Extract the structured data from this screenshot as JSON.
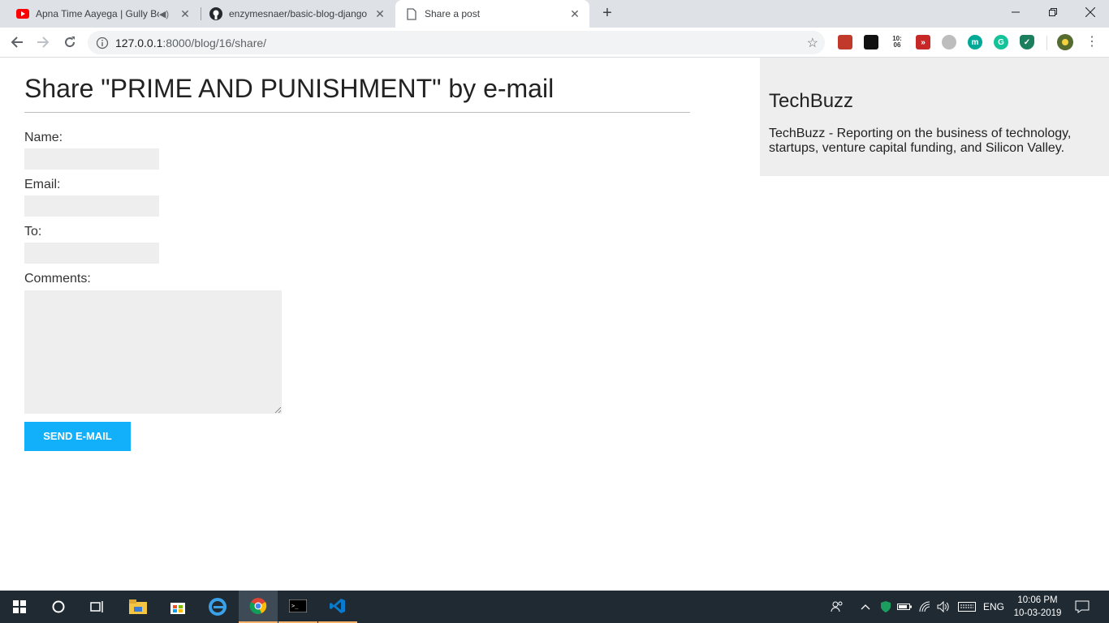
{
  "browser": {
    "tabs": [
      {
        "title": "Apna Time Aayega | Gully Bo",
        "audio": "speaker-icon"
      },
      {
        "title": "enzymesnaer/basic-blog-django"
      },
      {
        "title": "Share a post"
      }
    ],
    "address": {
      "host": "127.0.0.1",
      "path": ":8000/blog/16/share/"
    },
    "extensions": [
      {
        "icon": "bookmark-red-icon",
        "color": "#c0392b",
        "glyph": "■"
      },
      {
        "icon": "notes-black-icon",
        "color": "#111111",
        "glyph": "▆"
      },
      {
        "icon": "clock-badge-icon",
        "color": "#444444",
        "glyph": "10:06"
      },
      {
        "icon": "forward-red-icon",
        "color": "#c62828",
        "glyph": "»"
      },
      {
        "icon": "grey-circle-icon",
        "color": "#9e9e9e",
        "glyph": "◎"
      },
      {
        "icon": "m-teal-icon",
        "color": "#00a896",
        "glyph": "m"
      },
      {
        "icon": "grammarly-icon",
        "color": "#15c39a",
        "glyph": "G"
      },
      {
        "icon": "shield-green-icon",
        "color": "#1b7f5e",
        "glyph": "✓"
      }
    ]
  },
  "page": {
    "title": "Share \"PRIME AND PUNISHMENT\" by e-mail",
    "form": {
      "name_label": "Name:",
      "email_label": "Email:",
      "to_label": "To:",
      "comments_label": "Comments:",
      "submit_label": "SEND E-MAIL"
    },
    "sidebar": {
      "title": "TechBuzz",
      "description": "TechBuzz - Reporting on the business of technology, startups, venture capital funding, and Silicon Valley."
    }
  },
  "taskbar": {
    "language": "ENG",
    "time": "10:06 PM",
    "date": "10-03-2019"
  },
  "colors": {
    "accent_button": "#12b0fa",
    "sidebar_bg": "#eeeeee",
    "field_bg": "#eeeeee"
  }
}
